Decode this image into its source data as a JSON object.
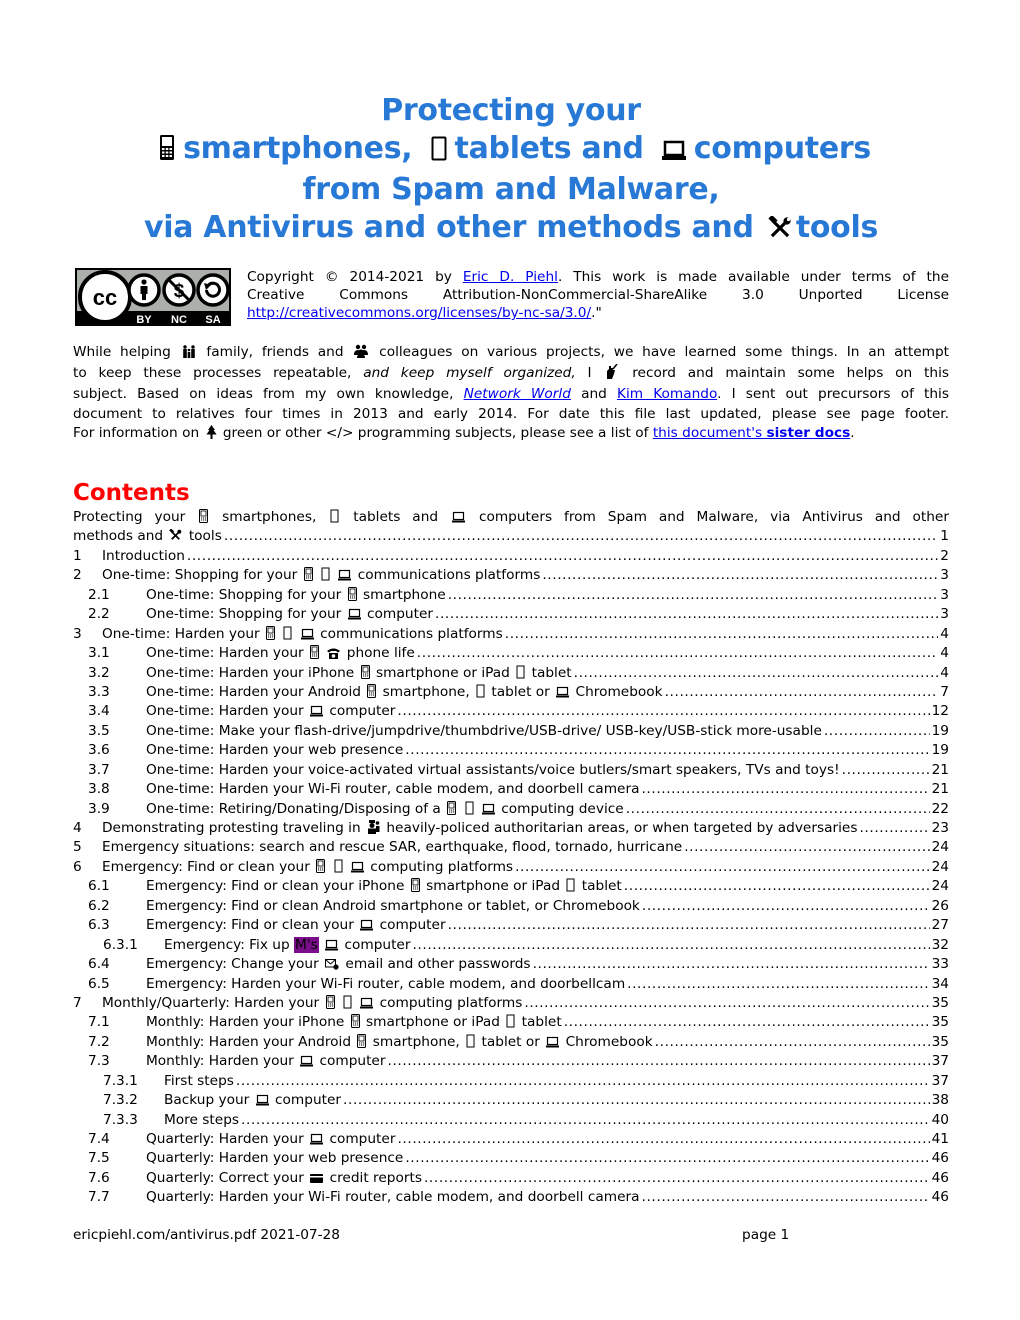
{
  "document": {
    "title": {
      "line1": "Protecting your",
      "line2_a": "smartphones,",
      "line2_b": "tablets and",
      "line2_c": "computers",
      "line3": "from Spam and Malware,",
      "line4_a": "via Antivirus and other methods and",
      "line4_b": "tools"
    },
    "license": {
      "badge": {
        "icons": [
          "cc-icon",
          "by-icon",
          "nc-icon",
          "sa-icon"
        ],
        "labels": [
          "BY",
          "NC",
          "SA"
        ]
      },
      "line1_prefix": "Copyright © 2014-2021 by ",
      "author_link": "Eric D. Piehl",
      "line1_suffix": ".  This work is made available under terms of the",
      "line2": "Creative Commons Attribution-NonCommercial-ShareAlike 3.0 Unported License",
      "url_link": "http://creativecommons.org/licenses/by-nc-sa/3.0/",
      "url_suffix": ".\""
    },
    "intro": {
      "l1_a": "While helping",
      "l1_b": "family, friends and",
      "l1_c": "colleagues on various projects, we have learned some things.  In an attempt",
      "l2_a": "to keep these processes repeatable,",
      "l2_italic": "and keep myself organized,",
      "l2_b": "I",
      "l2_c": "record and maintain some helps on this",
      "l3_a": "subject.  Based on ideas from my own knowledge,",
      "l3_link1": "Network World",
      "l3_b": "and",
      "l3_link2": "Kim Komando",
      "l3_c": ".  I sent out precursors of this",
      "l4": "document to relatives four times in 2013 and early 2014.  For date this file last updated, please see page footer.",
      "l5_a": "For information on",
      "l5_b": "green or other </> programming subjects, please see a list of",
      "l5_link": "this document's ",
      "l5_link_bold": "sister docs",
      "l5_end": "."
    },
    "contents": {
      "heading": "Contents",
      "first_entry": {
        "line1": "Protecting your [phone] smartphones, [tablet] tablets and [laptop] computers from Spam and Malware, via Antivirus and other",
        "l1_a": "Protecting your",
        "l1_b": "smartphones,",
        "l1_c": "tablets and",
        "l1_d": "computers from Spam and Malware, via Antivirus and other",
        "l2_a": "methods and",
        "l2_b": "tools",
        "page": "1"
      },
      "entries": [
        {
          "num": "1",
          "level": 1,
          "parts": [
            "Introduction"
          ],
          "page": "2"
        },
        {
          "num": "2",
          "level": 1,
          "parts": [
            "One-time:  Shopping for your",
            "@phone",
            "@tablet",
            "@laptop",
            "communications platforms"
          ],
          "page": "3"
        },
        {
          "num": "2.1",
          "level": 2,
          "parts": [
            "One-time:  Shopping for your",
            "@phone",
            "smartphone"
          ],
          "page": "3"
        },
        {
          "num": "2.2",
          "level": 2,
          "parts": [
            "One-time:  Shopping for your",
            "@laptop",
            "computer"
          ],
          "page": "3"
        },
        {
          "num": "3",
          "level": 1,
          "parts": [
            "One-time:  Harden your",
            "@phone",
            "@tablet",
            "@laptop",
            "communications platforms"
          ],
          "page": "4"
        },
        {
          "num": "3.1",
          "level": 2,
          "parts": [
            "One-time:  Harden your",
            "@phone",
            "@telephone",
            "phone life"
          ],
          "page": "4"
        },
        {
          "num": "3.2",
          "level": 2,
          "parts": [
            "One-time:  Harden your iPhone",
            "@phone",
            "smartphone or iPad",
            "@tablet",
            "tablet"
          ],
          "page": "4"
        },
        {
          "num": "3.3",
          "level": 2,
          "parts": [
            "One-time:  Harden your Android",
            "@phone",
            "smartphone,",
            "@tablet",
            "tablet  or",
            "@laptop",
            "Chromebook"
          ],
          "page": "7"
        },
        {
          "num": "3.4",
          "level": 2,
          "parts": [
            "One-time:  Harden your",
            "@laptop",
            "computer"
          ],
          "page": "12"
        },
        {
          "num": "3.5",
          "level": 2,
          "parts": [
            "One-time:  Make your flash-drive/jumpdrive/thumbdrive/USB-drive/ USB-key/USB-stick more-usable"
          ],
          "page": "19"
        },
        {
          "num": "3.6",
          "level": 2,
          "parts": [
            "One-time:  Harden your web presence"
          ],
          "page": "19"
        },
        {
          "num": "3.7",
          "level": 2,
          "parts": [
            "One-time:  Harden your voice-activated virtual assistants/voice butlers/smart speakers, TVs and toys!"
          ],
          "page": "21"
        },
        {
          "num": "3.8",
          "level": 2,
          "parts": [
            "One-time:  Harden your Wi-Fi router, cable modem, and doorbell camera"
          ],
          "page": "21"
        },
        {
          "num": "3.9",
          "level": 2,
          "parts": [
            "One-time:  Retiring/Donating/Disposing of a",
            "@phone",
            "@tablet",
            "@laptop",
            "computing device"
          ],
          "page": "22"
        },
        {
          "num": "4",
          "level": 1,
          "parts": [
            "Demonstrating protesting traveling in",
            "@police",
            "heavily-policed authoritarian areas, or when targeted by adversaries"
          ],
          "page": "23"
        },
        {
          "num": "5",
          "level": 1,
          "parts": [
            "Emergency situations:  search and rescue SAR, earthquake, flood, tornado, hurricane"
          ],
          "page": "24"
        },
        {
          "num": "6",
          "level": 1,
          "parts": [
            "Emergency:  Find or clean your",
            "@phone",
            "@tablet",
            "@laptop",
            "computing platforms"
          ],
          "page": "24"
        },
        {
          "num": "6.1",
          "level": 2,
          "parts": [
            "Emergency:  Find or clean your iPhone",
            "@phone",
            "smartphone or iPad",
            "@tablet",
            "tablet"
          ],
          "page": "24"
        },
        {
          "num": "6.2",
          "level": 2,
          "parts": [
            "Emergency:  Find or clean Android smartphone or tablet, or Chromebook"
          ],
          "page": "26"
        },
        {
          "num": "6.3",
          "level": 2,
          "parts": [
            "Emergency:  Find or clean your",
            "@laptop",
            "computer"
          ],
          "page": "27"
        },
        {
          "num": "6.3.1",
          "level": 3,
          "parts": [
            "Emergency:  Fix up",
            "#M's",
            "@laptop",
            "computer"
          ],
          "page": "32"
        },
        {
          "num": "6.4",
          "level": 2,
          "parts": [
            "Emergency:  Change your",
            "@email",
            "email and other passwords"
          ],
          "page": "33"
        },
        {
          "num": "6.5",
          "level": 2,
          "parts": [
            "Emergency:  Harden your Wi-Fi router, cable modem, and doorbellcam"
          ],
          "page": "34"
        },
        {
          "num": "7",
          "level": 1,
          "parts": [
            "Monthly/Quarterly:  Harden your",
            "@phone",
            "@tablet",
            "@laptop",
            "computing platforms"
          ],
          "page": "35"
        },
        {
          "num": "7.1",
          "level": 2,
          "parts": [
            "Monthly:  Harden your iPhone",
            "@phone",
            "smartphone or iPad",
            "@tablet",
            "tablet"
          ],
          "page": "35"
        },
        {
          "num": "7.2",
          "level": 2,
          "parts": [
            "Monthly:  Harden your Android",
            "@phone",
            "smartphone,",
            "@tablet",
            "tablet or",
            "@laptop",
            "Chromebook"
          ],
          "page": "35"
        },
        {
          "num": "7.3",
          "level": 2,
          "parts": [
            "Monthly:  Harden your",
            "@laptop",
            "computer"
          ],
          "page": "37"
        },
        {
          "num": "7.3.1",
          "level": 3,
          "parts": [
            "First steps"
          ],
          "page": "37"
        },
        {
          "num": "7.3.2",
          "level": 3,
          "parts": [
            "Backup your",
            "@laptop",
            "computer"
          ],
          "page": "38"
        },
        {
          "num": "7.3.3",
          "level": 3,
          "parts": [
            "More steps"
          ],
          "page": "40"
        },
        {
          "num": "7.4",
          "level": 2,
          "parts": [
            "Quarterly:  Harden your",
            "@laptop",
            "computer"
          ],
          "page": "41"
        },
        {
          "num": "7.5",
          "level": 2,
          "parts": [
            "Quarterly:  Harden your web presence"
          ],
          "page": "46"
        },
        {
          "num": "7.6",
          "level": 2,
          "parts": [
            "Quarterly:  Correct your",
            "@card",
            "credit reports"
          ],
          "page": "46"
        },
        {
          "num": "7.7",
          "level": 2,
          "parts": [
            "Quarterly:  Harden your Wi-Fi router, cable modem, and doorbell camera"
          ],
          "page": "46"
        }
      ]
    },
    "footer": {
      "left": "ericpiehl.com/antivirus.pdf  2021-07-28",
      "right": "page 1"
    },
    "colors": {
      "title": "#2878d6",
      "contents_heading": "#ff0000",
      "link": "#0000ee",
      "highlight": "#7a0e8a"
    }
  }
}
